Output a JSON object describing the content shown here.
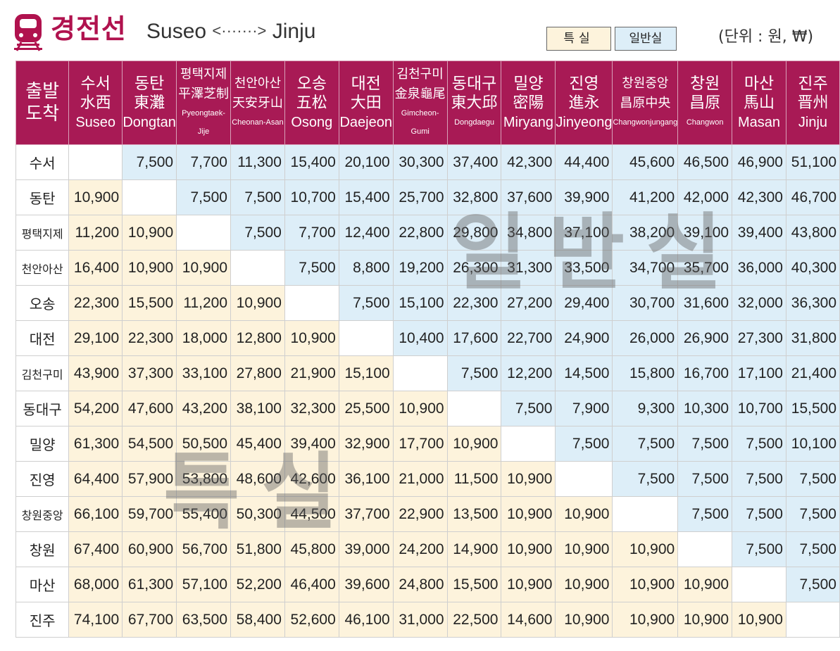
{
  "header": {
    "title_kr": "경전선",
    "route_from": "Suseo",
    "route_arrow": "<·······>",
    "route_to": "Jinju",
    "legend_special": "특실",
    "legend_general": "일반실",
    "unit": "(단위 : 원, ₩)",
    "icon": "train-icon",
    "accent_color": "#a81a55"
  },
  "table": {
    "corner": {
      "top": "출발",
      "bottom": "도착"
    },
    "columns": [
      {
        "kr": "수서",
        "hanja": "水西",
        "en": "Suseo",
        "small": false
      },
      {
        "kr": "동탄",
        "hanja": "東灘",
        "en": "Dongtan",
        "small": false
      },
      {
        "kr": "평택지제",
        "hanja": "平澤芝制",
        "en": "Pyeongtaek-Jije",
        "small": true
      },
      {
        "kr": "천안아산",
        "hanja": "天安牙山",
        "en": "Cheonan-Asan",
        "small": true
      },
      {
        "kr": "오송",
        "hanja": "五松",
        "en": "Osong",
        "small": false
      },
      {
        "kr": "대전",
        "hanja": "大田",
        "en": "Daejeon",
        "small": false
      },
      {
        "kr": "김천구미",
        "hanja": "金泉龜尾",
        "en": "Gimcheon-Gumi",
        "small": true
      },
      {
        "kr": "동대구",
        "hanja": "東大邱",
        "en": "Dongdaegu",
        "small": true
      },
      {
        "kr": "밀양",
        "hanja": "密陽",
        "en": "Miryang",
        "small": false
      },
      {
        "kr": "진영",
        "hanja": "進永",
        "en": "Jinyeong",
        "small": false
      },
      {
        "kr": "창원중앙",
        "hanja": "昌原中央",
        "en": "Changwonjungang",
        "small": true
      },
      {
        "kr": "창원",
        "hanja": "昌原",
        "en": "Changwon",
        "small": true
      },
      {
        "kr": "마산",
        "hanja": "馬山",
        "en": "Masan",
        "small": false
      },
      {
        "kr": "진주",
        "hanja": "晋州",
        "en": "Jinju",
        "small": false
      }
    ],
    "rows": [
      {
        "station": "수서",
        "small": false,
        "fares": [
          "",
          "7,500",
          "7,700",
          "11,300",
          "15,400",
          "20,100",
          "30,300",
          "37,400",
          "42,300",
          "44,400",
          "45,600",
          "46,500",
          "46,900",
          "51,100"
        ]
      },
      {
        "station": "동탄",
        "small": false,
        "fares": [
          "10,900",
          "",
          "7,500",
          "7,500",
          "10,700",
          "15,400",
          "25,700",
          "32,800",
          "37,600",
          "39,900",
          "41,200",
          "42,000",
          "42,300",
          "46,700"
        ]
      },
      {
        "station": "평택지제",
        "small": true,
        "fares": [
          "11,200",
          "10,900",
          "",
          "7,500",
          "7,700",
          "12,400",
          "22,800",
          "29,800",
          "34,800",
          "37,100",
          "38,200",
          "39,100",
          "39,400",
          "43,800"
        ]
      },
      {
        "station": "천안아산",
        "small": true,
        "fares": [
          "16,400",
          "10,900",
          "10,900",
          "",
          "7,500",
          "8,800",
          "19,200",
          "26,300",
          "31,300",
          "33,500",
          "34,700",
          "35,700",
          "36,000",
          "40,300"
        ]
      },
      {
        "station": "오송",
        "small": false,
        "fares": [
          "22,300",
          "15,500",
          "11,200",
          "10,900",
          "",
          "7,500",
          "15,100",
          "22,300",
          "27,200",
          "29,400",
          "30,700",
          "31,600",
          "32,000",
          "36,300"
        ]
      },
      {
        "station": "대전",
        "small": false,
        "fares": [
          "29,100",
          "22,300",
          "18,000",
          "12,800",
          "10,900",
          "",
          "10,400",
          "17,600",
          "22,700",
          "24,900",
          "26,000",
          "26,900",
          "27,300",
          "31,800"
        ]
      },
      {
        "station": "김천구미",
        "small": true,
        "fares": [
          "43,900",
          "37,300",
          "33,100",
          "27,800",
          "21,900",
          "15,100",
          "",
          "7,500",
          "12,200",
          "14,500",
          "15,800",
          "16,700",
          "17,100",
          "21,400"
        ]
      },
      {
        "station": "동대구",
        "small": false,
        "fares": [
          "54,200",
          "47,600",
          "43,200",
          "38,100",
          "32,300",
          "25,500",
          "10,900",
          "",
          "7,500",
          "7,900",
          "9,300",
          "10,300",
          "10,700",
          "15,500"
        ]
      },
      {
        "station": "밀양",
        "small": false,
        "fares": [
          "61,300",
          "54,500",
          "50,500",
          "45,400",
          "39,400",
          "32,900",
          "17,700",
          "10,900",
          "",
          "7,500",
          "7,500",
          "7,500",
          "7,500",
          "10,100"
        ]
      },
      {
        "station": "진영",
        "small": false,
        "fares": [
          "64,400",
          "57,900",
          "53,800",
          "48,600",
          "42,600",
          "36,100",
          "21,000",
          "11,500",
          "10,900",
          "",
          "7,500",
          "7,500",
          "7,500",
          "7,500"
        ]
      },
      {
        "station": "창원중앙",
        "small": true,
        "fares": [
          "66,100",
          "59,700",
          "55,400",
          "50,300",
          "44,500",
          "37,700",
          "22,900",
          "13,500",
          "10,900",
          "10,900",
          "",
          "7,500",
          "7,500",
          "7,500"
        ]
      },
      {
        "station": "창원",
        "small": false,
        "fares": [
          "67,400",
          "60,900",
          "56,700",
          "51,800",
          "45,800",
          "39,000",
          "24,200",
          "14,900",
          "10,900",
          "10,900",
          "10,900",
          "",
          "7,500",
          "7,500"
        ]
      },
      {
        "station": "마산",
        "small": false,
        "fares": [
          "68,000",
          "61,300",
          "57,100",
          "52,200",
          "46,400",
          "39,600",
          "24,800",
          "15,500",
          "10,900",
          "10,900",
          "10,900",
          "10,900",
          "",
          "7,500"
        ]
      },
      {
        "station": "진주",
        "small": false,
        "fares": [
          "74,100",
          "67,700",
          "63,500",
          "58,400",
          "52,600",
          "46,100",
          "31,000",
          "22,500",
          "14,600",
          "10,900",
          "10,900",
          "10,900",
          "10,900",
          ""
        ]
      }
    ]
  },
  "watermarks": {
    "general": "일반실",
    "special": "특실"
  },
  "colors": {
    "special_bg": "#fdf3dc",
    "general_bg": "#ddeef8",
    "header_bg": "#a81a55"
  }
}
